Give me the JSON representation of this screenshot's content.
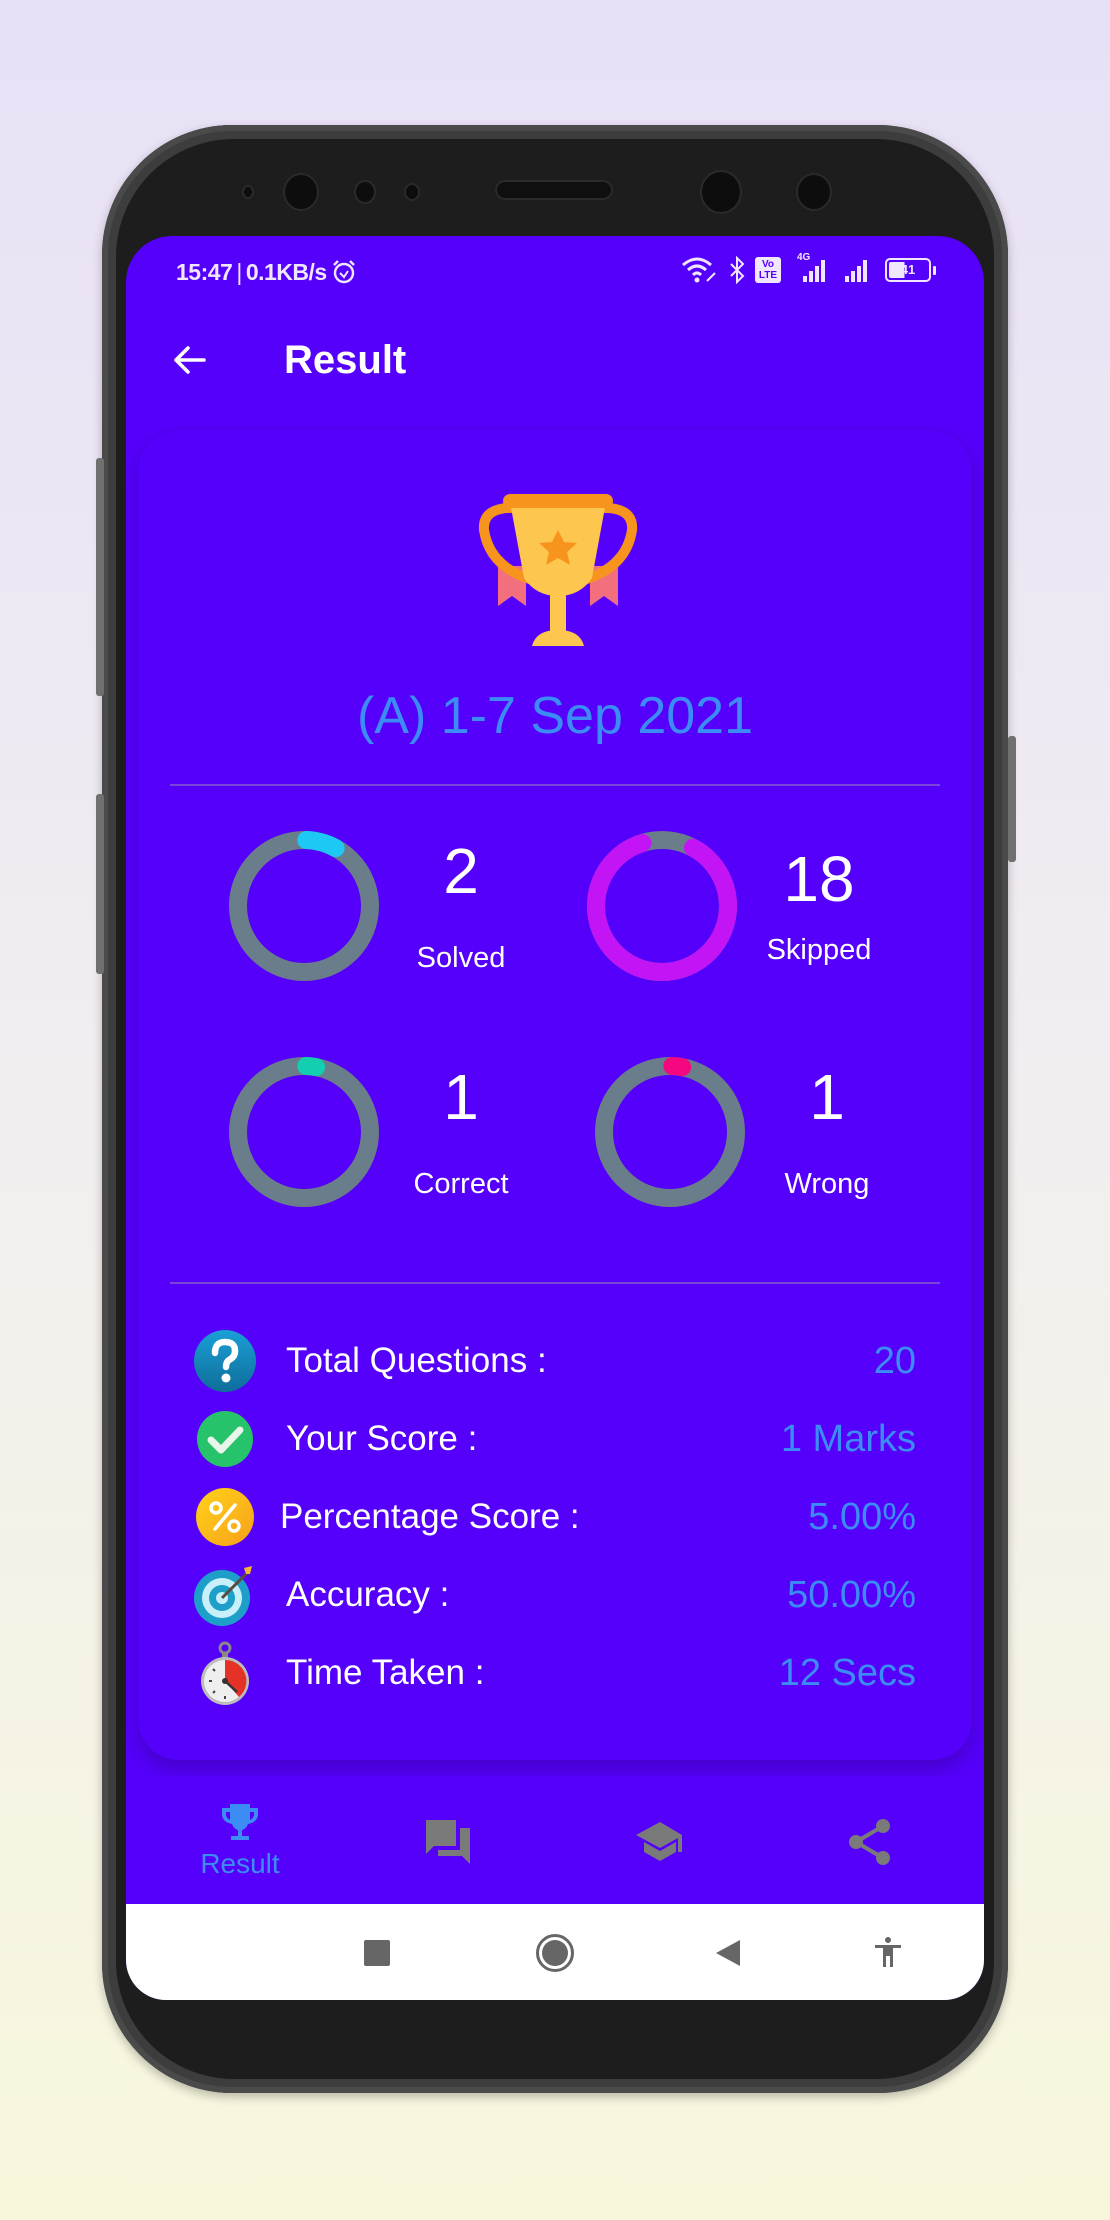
{
  "status_bar": {
    "time": "15:47",
    "separator": "|",
    "network_speed": "0.1KB/s",
    "icons": [
      "alarm-icon",
      "wifi-icon",
      "bluetooth-icon",
      "volte-icon",
      "signal-4g-icon",
      "signal-icon",
      "battery-icon"
    ],
    "volte_top": "Vo",
    "volte_bottom": "LTE",
    "network_type": "4G",
    "battery_level": "41"
  },
  "app_bar": {
    "title": "Result",
    "back_icon": "arrow-left-icon"
  },
  "result_card": {
    "trophy_icon": "trophy-icon",
    "quiz_title": "(A) 1-7 Sep 2021",
    "stats": [
      {
        "label": "Solved",
        "value": "2",
        "fraction": 0.1,
        "color": "#1ec8f5",
        "track": "#6a7d8a"
      },
      {
        "label": "Skipped",
        "value": "18",
        "fraction": 0.9,
        "color": "#c214f5",
        "track": "#6a7d8a"
      },
      {
        "label": "Correct",
        "value": "1",
        "fraction": 0.05,
        "color": "#13cfb0",
        "track": "#6a7d8a"
      },
      {
        "label": "Wrong",
        "value": "1",
        "fraction": 0.05,
        "color": "#f5087f",
        "track": "#6a7d8a"
      }
    ],
    "details": [
      {
        "icon": "question-icon",
        "label": "Total Questions :",
        "value": "20"
      },
      {
        "icon": "check-icon",
        "label": "Your Score :",
        "value": "1 Marks"
      },
      {
        "icon": "percent-icon",
        "label": "Percentage Score :",
        "value": "5.00%"
      },
      {
        "icon": "target-icon",
        "label": "Accuracy :",
        "value": "50.00%"
      },
      {
        "icon": "stopwatch-icon",
        "label": "Time Taken :",
        "value": "12 Secs"
      }
    ]
  },
  "bottom_nav": {
    "items": [
      {
        "icon": "trophy-icon",
        "label": "Result",
        "active": true
      },
      {
        "icon": "forum-icon",
        "label": "",
        "active": false
      },
      {
        "icon": "school-icon",
        "label": "",
        "active": false
      },
      {
        "icon": "share-icon",
        "label": "",
        "active": false
      }
    ],
    "active_color": "#3b8df5",
    "inactive_color": "#7a7a7a"
  },
  "system_nav": {
    "items": [
      "recents-icon",
      "home-icon",
      "back-icon",
      "accessibility-icon"
    ]
  },
  "colors": {
    "primary": "#5500fb",
    "accent": "#3b8df5",
    "ring_track": "#6a7d8a"
  }
}
